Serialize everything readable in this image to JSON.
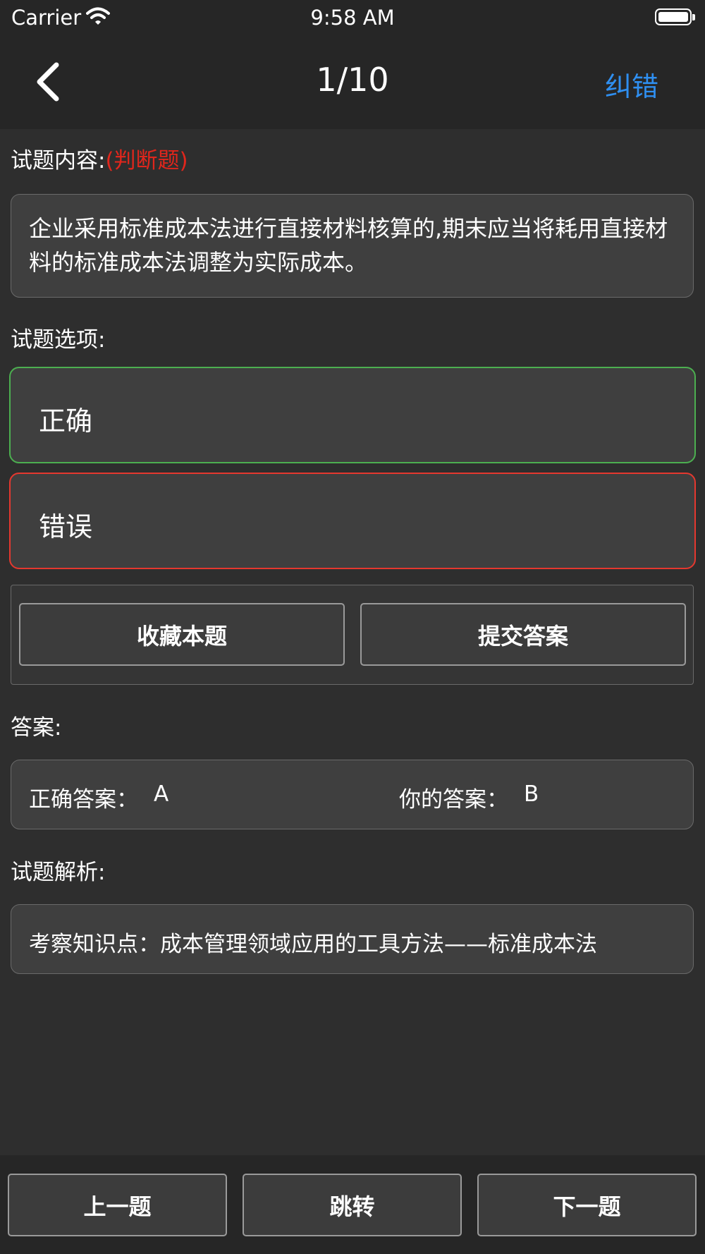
{
  "status_bar": {
    "carrier": "Carrier",
    "time": "9:58 AM"
  },
  "nav": {
    "title": "1/10",
    "report_error": "纠错"
  },
  "question": {
    "label": "试题内容:",
    "type": "(判断题)",
    "text": "企业采用标准成本法进行直接材料核算的,期末应当将耗用直接材料的标准成本法调整为实际成本。"
  },
  "options_section": {
    "label": "试题选项:",
    "items": [
      {
        "label": "正确",
        "state": "correct"
      },
      {
        "label": "错误",
        "state": "wrong"
      }
    ]
  },
  "actions": {
    "favorite": "收藏本题",
    "submit": "提交答案"
  },
  "answer": {
    "label": "答案:",
    "correct_label": "正确答案：",
    "correct_value": "A",
    "yours_label": "你的答案：",
    "yours_value": "B"
  },
  "analysis": {
    "label": "试题解析:",
    "text": "考察知识点：成本管理领域应用的工具方法——标准成本法"
  },
  "bottom_nav": {
    "prev": "上一题",
    "jump": "跳转",
    "next": "下一题"
  },
  "colors": {
    "accent": "#2f8ff0",
    "correct": "#4caf50",
    "wrong": "#e5382f",
    "type_tag": "#e0261c",
    "background": "#2e2e2e"
  }
}
